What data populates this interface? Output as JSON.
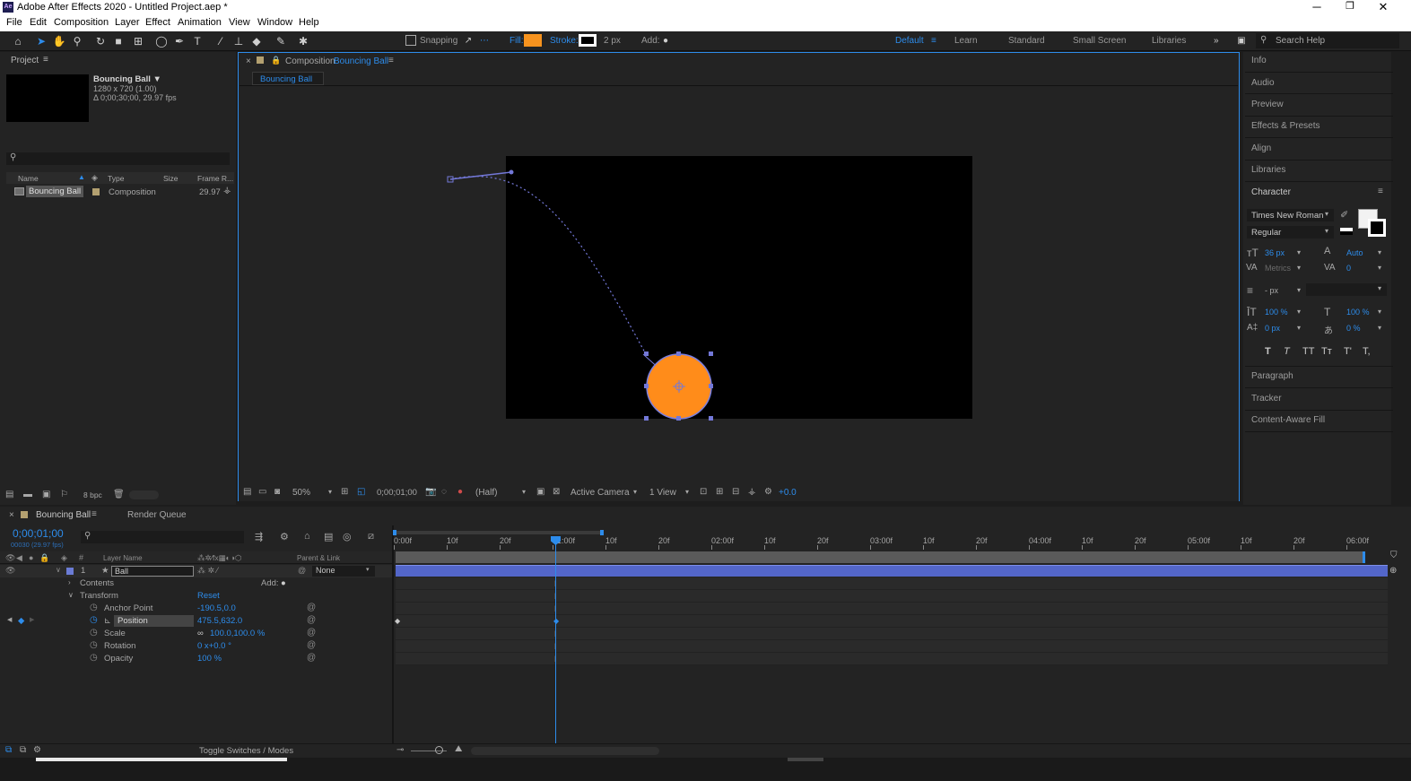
{
  "window": {
    "app_title": "Adobe After Effects 2020 - Untitled Project.aep *",
    "logo": "Ae",
    "minimize": "─",
    "restore": "❐",
    "close": "✕"
  },
  "menu": [
    "File",
    "Edit",
    "Composition",
    "Layer",
    "Effect",
    "Animation",
    "View",
    "Window",
    "Help"
  ],
  "toolbar": {
    "snapping": "Snapping",
    "fill_label": "Fill:",
    "fill_color": "#f7931e",
    "stroke_label": "Stroke:",
    "stroke_width": "2 px",
    "add_label": "Add:",
    "workspaces": [
      "Default",
      "Learn",
      "Standard",
      "Small Screen",
      "Libraries"
    ],
    "search_placeholder": "Search Help"
  },
  "project": {
    "title": "Project",
    "comp_name": "Bouncing Ball ▼",
    "comp_res": "1280 x 720 (1.00)",
    "comp_dur": "Δ 0;00;30;00, 29.97 fps",
    "columns": [
      "Name",
      "Type",
      "Size",
      "Frame R..."
    ],
    "items": [
      {
        "name": "Bouncing Ball",
        "type": "Composition",
        "fps": "29.97"
      }
    ],
    "bpc": "8 bpc"
  },
  "composition": {
    "panel_title": "Composition",
    "comp_name": "Bouncing Ball",
    "tab": "Bouncing Ball",
    "zoom": "50%",
    "timecode": "0;00;01;00",
    "resolution": "(Half)",
    "camera": "Active Camera",
    "views": "1 View",
    "exposure": "+0.0",
    "ball_color": "#ff8c1a"
  },
  "right_panels": [
    "Info",
    "Audio",
    "Preview",
    "Effects & Presets",
    "Align",
    "Libraries"
  ],
  "character": {
    "title": "Character",
    "font": "Times New Roman",
    "style": "Regular",
    "size": "36 px",
    "leading": "Auto",
    "kerning": "Metrics",
    "tracking": "0",
    "stroke": "- px",
    "v_scale": "100 %",
    "h_scale": "100 %",
    "baseline": "0 px",
    "tsume": "0 %",
    "style_buttons": [
      "T",
      "T",
      "TT",
      "Tт",
      "T'",
      "T,"
    ]
  },
  "right_panels_bottom": [
    "Paragraph",
    "Tracker",
    "Content-Aware Fill"
  ],
  "timeline": {
    "tab": "Bouncing Ball",
    "render_queue": "Render Queue",
    "timecode": "0;00;01;00",
    "timecode_sub": "00030 (29.97 fps)",
    "col_layer_name": "Layer Name",
    "col_parent": "Parent & Link",
    "layer_num": "1",
    "layer_name": "Ball",
    "parent_value": "None",
    "contents": "Contents",
    "add_label": "Add:",
    "transform": "Transform",
    "reset": "Reset",
    "props": [
      {
        "name": "Anchor Point",
        "value": "-190.5,0.0"
      },
      {
        "name": "Position",
        "value": "475.5,632.0"
      },
      {
        "name": "Scale",
        "value": "100.0,100.0 %"
      },
      {
        "name": "Rotation",
        "value": "0 x+0.0 °"
      },
      {
        "name": "Opacity",
        "value": "100 %"
      }
    ],
    "ruler": [
      "0:00f",
      "10f",
      "20f",
      "01:00f",
      "10f",
      "20f",
      "02:00f",
      "10f",
      "20f",
      "03:00f",
      "10f",
      "20f",
      "04:00f",
      "10f",
      "20f",
      "05:00f",
      "10f",
      "20f",
      "06:00f"
    ],
    "toggle": "Toggle Switches / Modes"
  }
}
